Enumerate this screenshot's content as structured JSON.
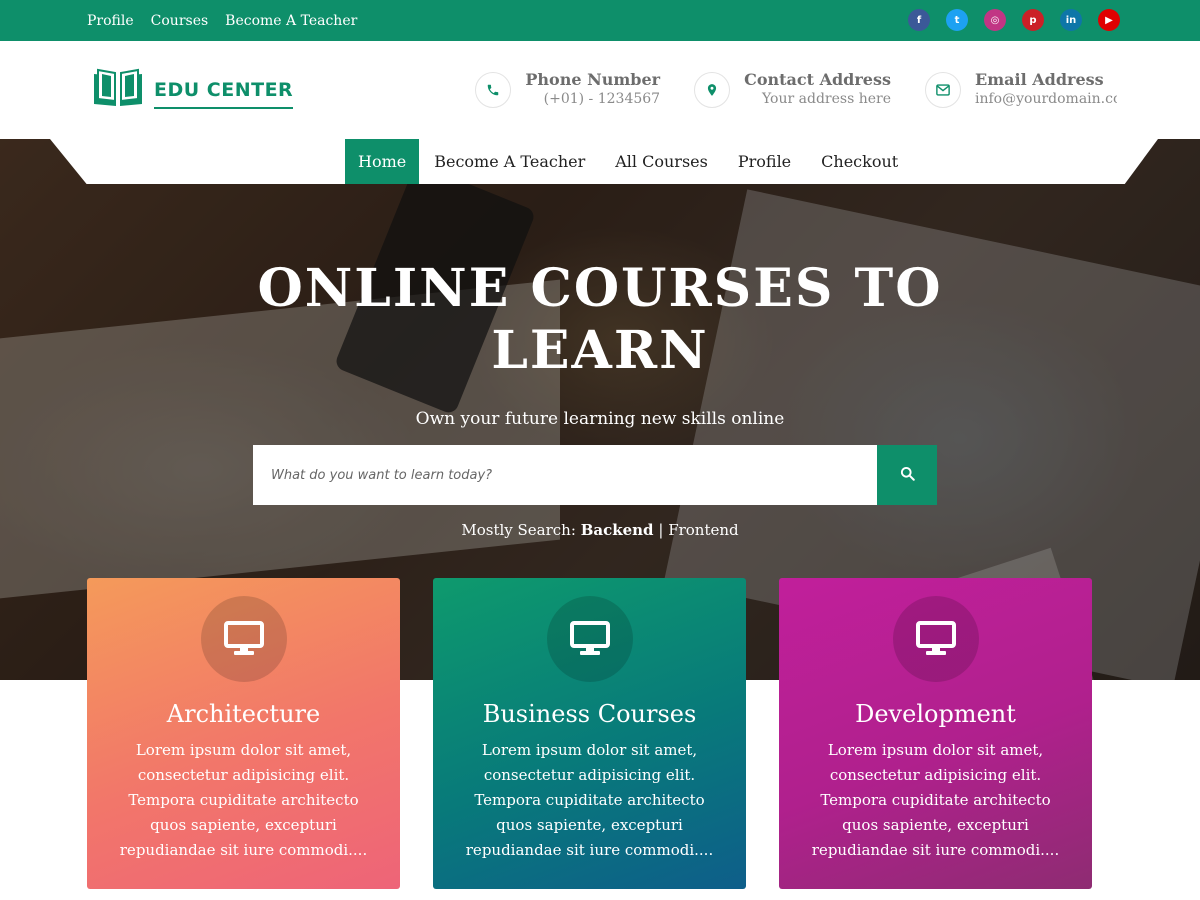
{
  "topbar": {
    "links": [
      "Profile",
      "Courses",
      "Become A Teacher"
    ],
    "social": [
      {
        "icon": "facebook-icon",
        "glyph": "f",
        "color": "#3b5998"
      },
      {
        "icon": "twitter-icon",
        "glyph": "t",
        "color": "#1da1f2"
      },
      {
        "icon": "instagram-icon",
        "glyph": "◎",
        "color": "#c13584"
      },
      {
        "icon": "pinterest-icon",
        "glyph": "p",
        "color": "#cb2027"
      },
      {
        "icon": "linkedin-icon",
        "glyph": "in",
        "color": "#0e76a8"
      },
      {
        "icon": "youtube-icon",
        "glyph": "▶",
        "color": "#e00000"
      }
    ]
  },
  "header": {
    "logo_text": "EDU CENTER",
    "brand_color": "#0e8f6a",
    "contacts": [
      {
        "title": "Phone Number",
        "value": "(+01) - 1234567",
        "icon": "phone-icon"
      },
      {
        "title": "Contact Address",
        "value": "Your address here",
        "icon": "location-pin-icon"
      },
      {
        "title": "Email Address",
        "value": "info@yourdomain.com",
        "icon": "envelope-icon"
      }
    ]
  },
  "nav": {
    "items": [
      "Home",
      "Become A Teacher",
      "All Courses",
      "Profile",
      "Checkout"
    ],
    "active": "Home"
  },
  "hero": {
    "title_line1": "ONLINE COURSES TO",
    "title_line2": "LEARN",
    "subtitle": "Own your future learning new skills online",
    "search_placeholder": "What do you want to learn today?",
    "mostly_label": "Mostly Search:",
    "mostly_first": "Backend",
    "mostly_sep": "|",
    "mostly_second": "Frontend"
  },
  "cards": [
    {
      "title": "Architecture",
      "icon": "monitor-icon",
      "text": "Lorem ipsum dolor sit amet, consectetur adipisicing elit. Tempora cupiditate architecto quos sapiente, excepturi repudiandae sit iure commodi...."
    },
    {
      "title": "Business Courses",
      "icon": "monitor-icon",
      "text": "Lorem ipsum dolor sit amet, consectetur adipisicing elit. Tempora cupiditate architecto quos sapiente, excepturi repudiandae sit iure commodi...."
    },
    {
      "title": "Development",
      "icon": "monitor-icon",
      "text": "Lorem ipsum dolor sit amet, consectetur adipisicing elit. Tempora cupiditate architecto quos sapiente, excepturi repudiandae sit iure commodi...."
    }
  ]
}
